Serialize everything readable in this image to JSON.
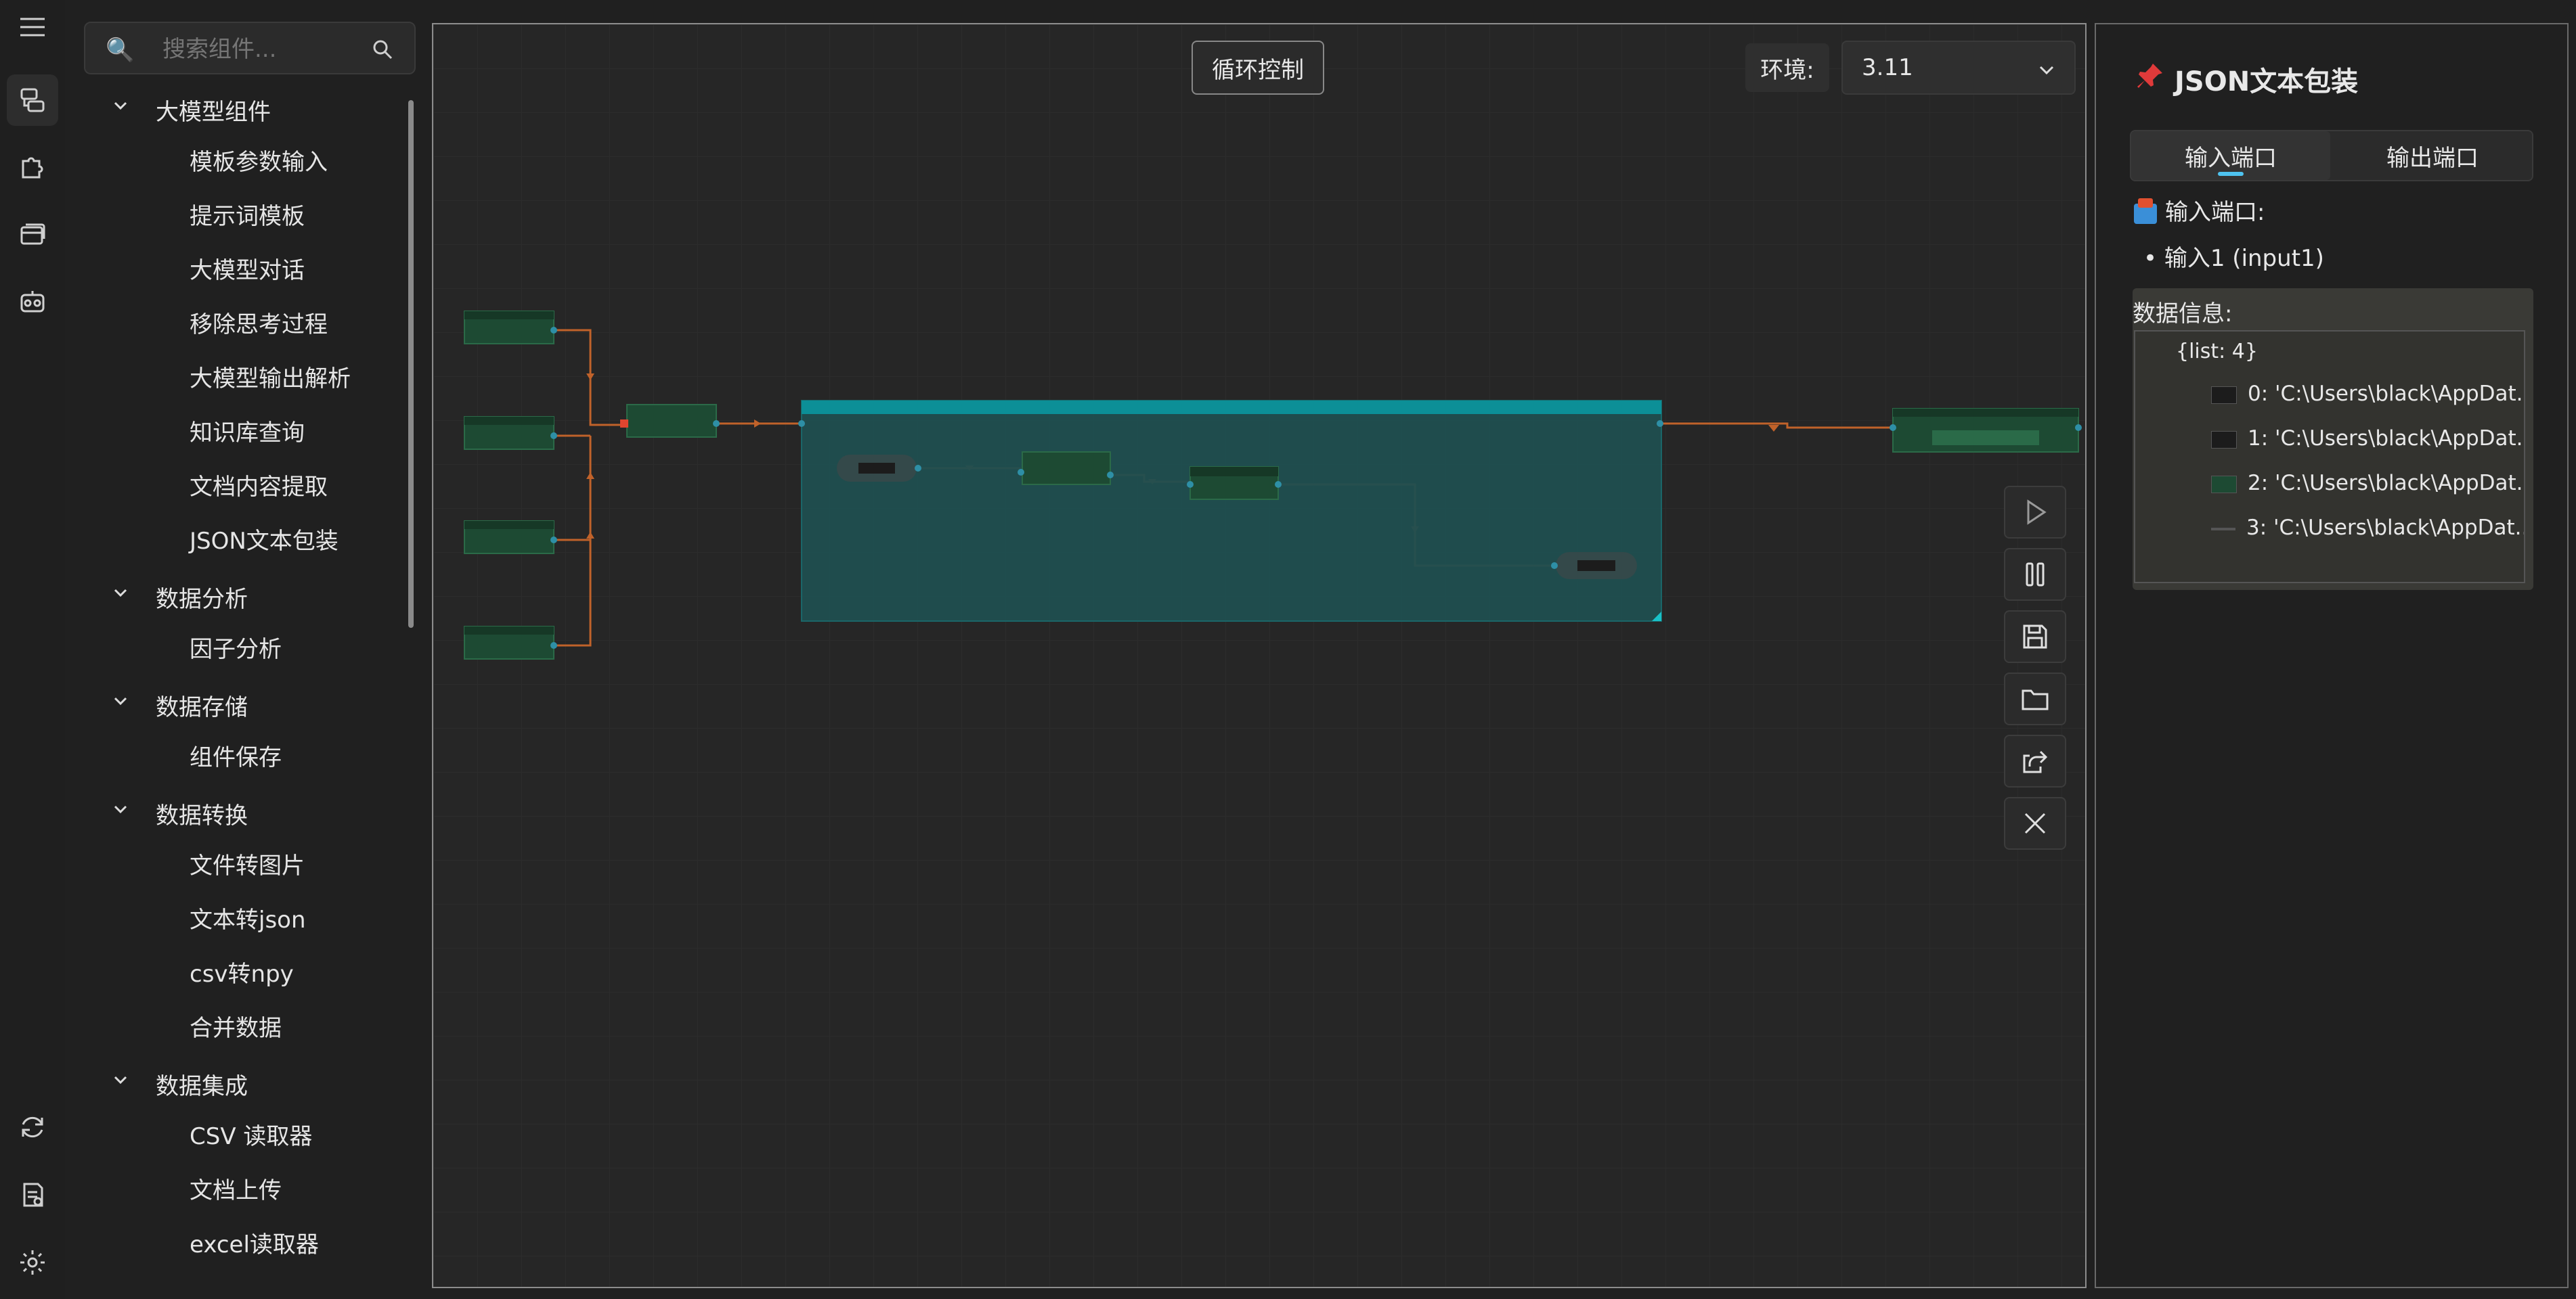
{
  "sidebar": {
    "search_placeholder": "搜索组件...",
    "categories": [
      {
        "label": "大模型组件",
        "items": [
          "模板参数输入",
          "提示词模板",
          "大模型对话",
          "移除思考过程",
          "大模型输出解析",
          "知识库查询",
          "文档内容提取",
          "JSON文本包装"
        ]
      },
      {
        "label": "数据分析",
        "items": [
          "因子分析"
        ]
      },
      {
        "label": "数据存储",
        "items": [
          "组件保存"
        ]
      },
      {
        "label": "数据转换",
        "items": [
          "文件转图片",
          "文本转json",
          "csv转npy",
          "合并数据"
        ]
      },
      {
        "label": "数据集成",
        "items": [
          "CSV 读取器",
          "文档上传",
          "excel读取器"
        ]
      }
    ]
  },
  "canvas": {
    "loop_button": "循环控制",
    "env_label": "环境:",
    "env_value": "3.11"
  },
  "props": {
    "title": "JSON文本包装",
    "tab_input": "输入端口",
    "tab_output": "输出端口",
    "input_heading": "输入端口:",
    "input_item": "• 输入1 (input1)",
    "data_heading": "数据信息:",
    "data_root": "{list: 4}",
    "data_rows": [
      "0: 'C:\\Users\\black\\AppDat...",
      "1: 'C:\\Users\\black\\AppDat...",
      "2: 'C:\\Users\\black\\AppDat...",
      "3: 'C:\\Users\\black\\AppDat..."
    ]
  },
  "colors": {
    "accent_tab": "#4ec3f0",
    "group_header": "#0c8f97",
    "group_body": "#1f4f50",
    "node_fill": "#1d4a33",
    "edge": "#c0622a"
  }
}
